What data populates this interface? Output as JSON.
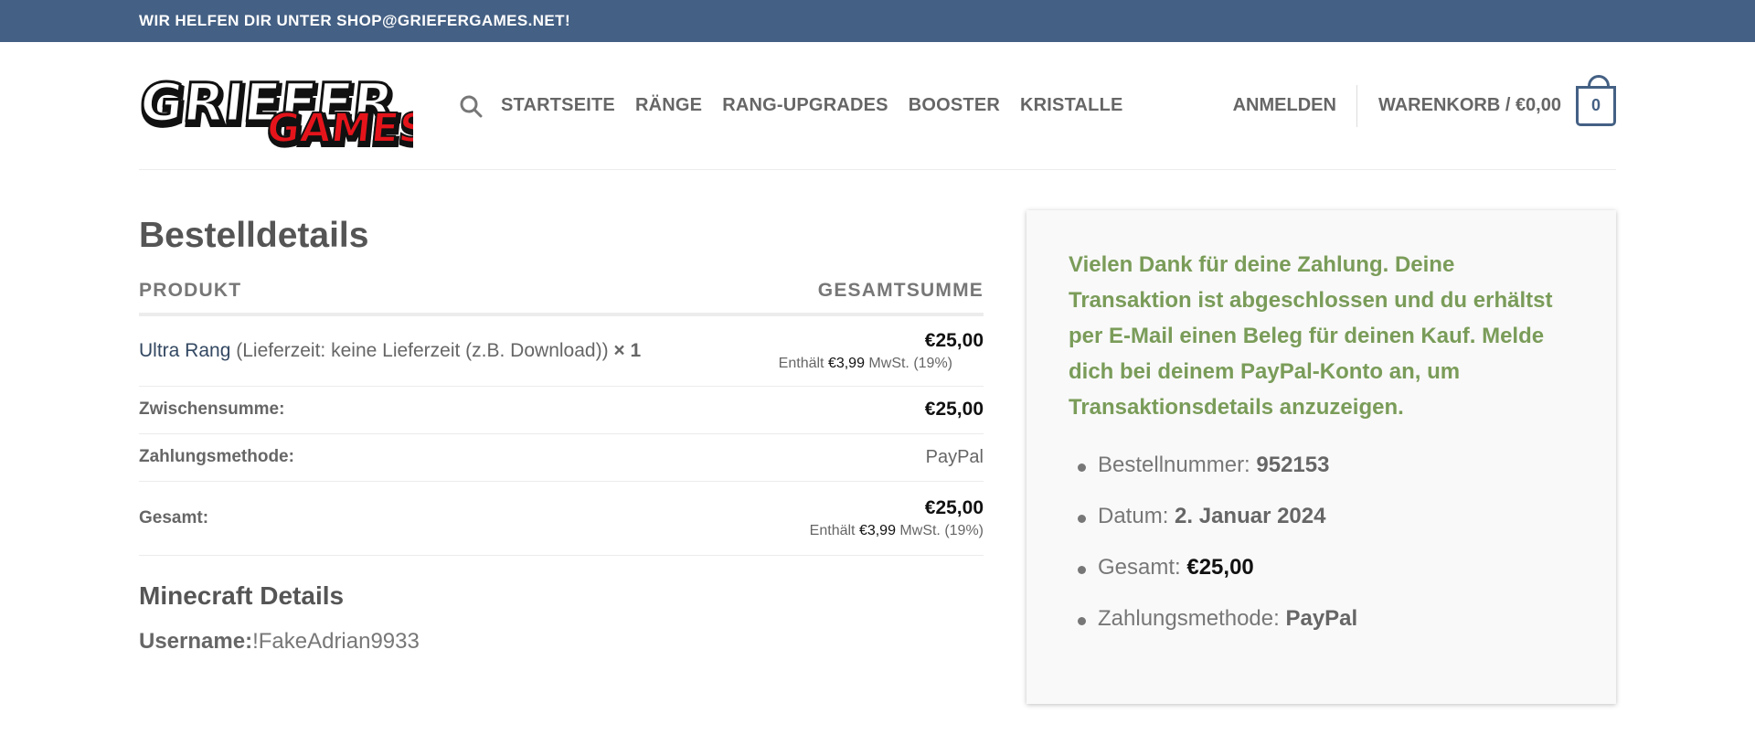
{
  "topbar": {
    "text": "WIR HELFEN DIR UNTER SHOP@GRIEFERGAMES.NET!"
  },
  "logo": {
    "line1": "GRIEFER",
    "line2": "GAMES"
  },
  "nav": {
    "items": [
      "STARTSEITE",
      "RÄNGE",
      "RANG-UPGRADES",
      "BOOSTER",
      "KRISTALLE"
    ],
    "login": "ANMELDEN",
    "cart_label": "WARENKORB / €0,00",
    "cart_count": "0"
  },
  "order": {
    "title": "Bestelldetails",
    "col_product": "PRODUKT",
    "col_total": "GESAMTSUMME",
    "product": {
      "name": "Ultra Rang",
      "meta": " (Lieferzeit: keine Lieferzeit (z.B. Download))",
      "qty": " × 1",
      "price": "€25,00",
      "tax_prefix": "Enthält ",
      "tax_value": "€3,99",
      "tax_suffix": " MwSt. (19%)"
    },
    "subtotal_label": "Zwischensumme:",
    "subtotal_value": "€25,00",
    "payment_label": "Zahlungsmethode:",
    "payment_value": "PayPal",
    "total_label": "Gesamt:",
    "total_value": "€25,00",
    "total_tax_prefix": "Enthält ",
    "total_tax_value": "€3,99",
    "total_tax_suffix": " MwSt. (19%)"
  },
  "minecraft": {
    "title": "Minecraft Details",
    "username_label": "Username:",
    "username_value": "!FakeAdrian9933"
  },
  "thanks": {
    "message": "Vielen Dank für deine Zahlung. Deine Transaktion ist abgeschlossen und du erhältst per E-Mail einen Beleg für deinen Kauf. Melde dich bei deinem PayPal-Konto an, um Transaktionsdetails anzuzeigen.",
    "order_number_label": "Bestellnummer: ",
    "order_number": "952153",
    "date_label": "Datum: ",
    "date": "2. Januar 2024",
    "total_label": "Gesamt: ",
    "total": "€25,00",
    "payment_label": "Zahlungsmethode: ",
    "payment": "PayPal"
  },
  "colors": {
    "topbar": "#446084",
    "success_text": "#7a9c59",
    "link": "#334862",
    "logo_red": "#e5141b"
  },
  "icons": {
    "search": "search-icon",
    "cart": "shopping-bag-icon"
  }
}
